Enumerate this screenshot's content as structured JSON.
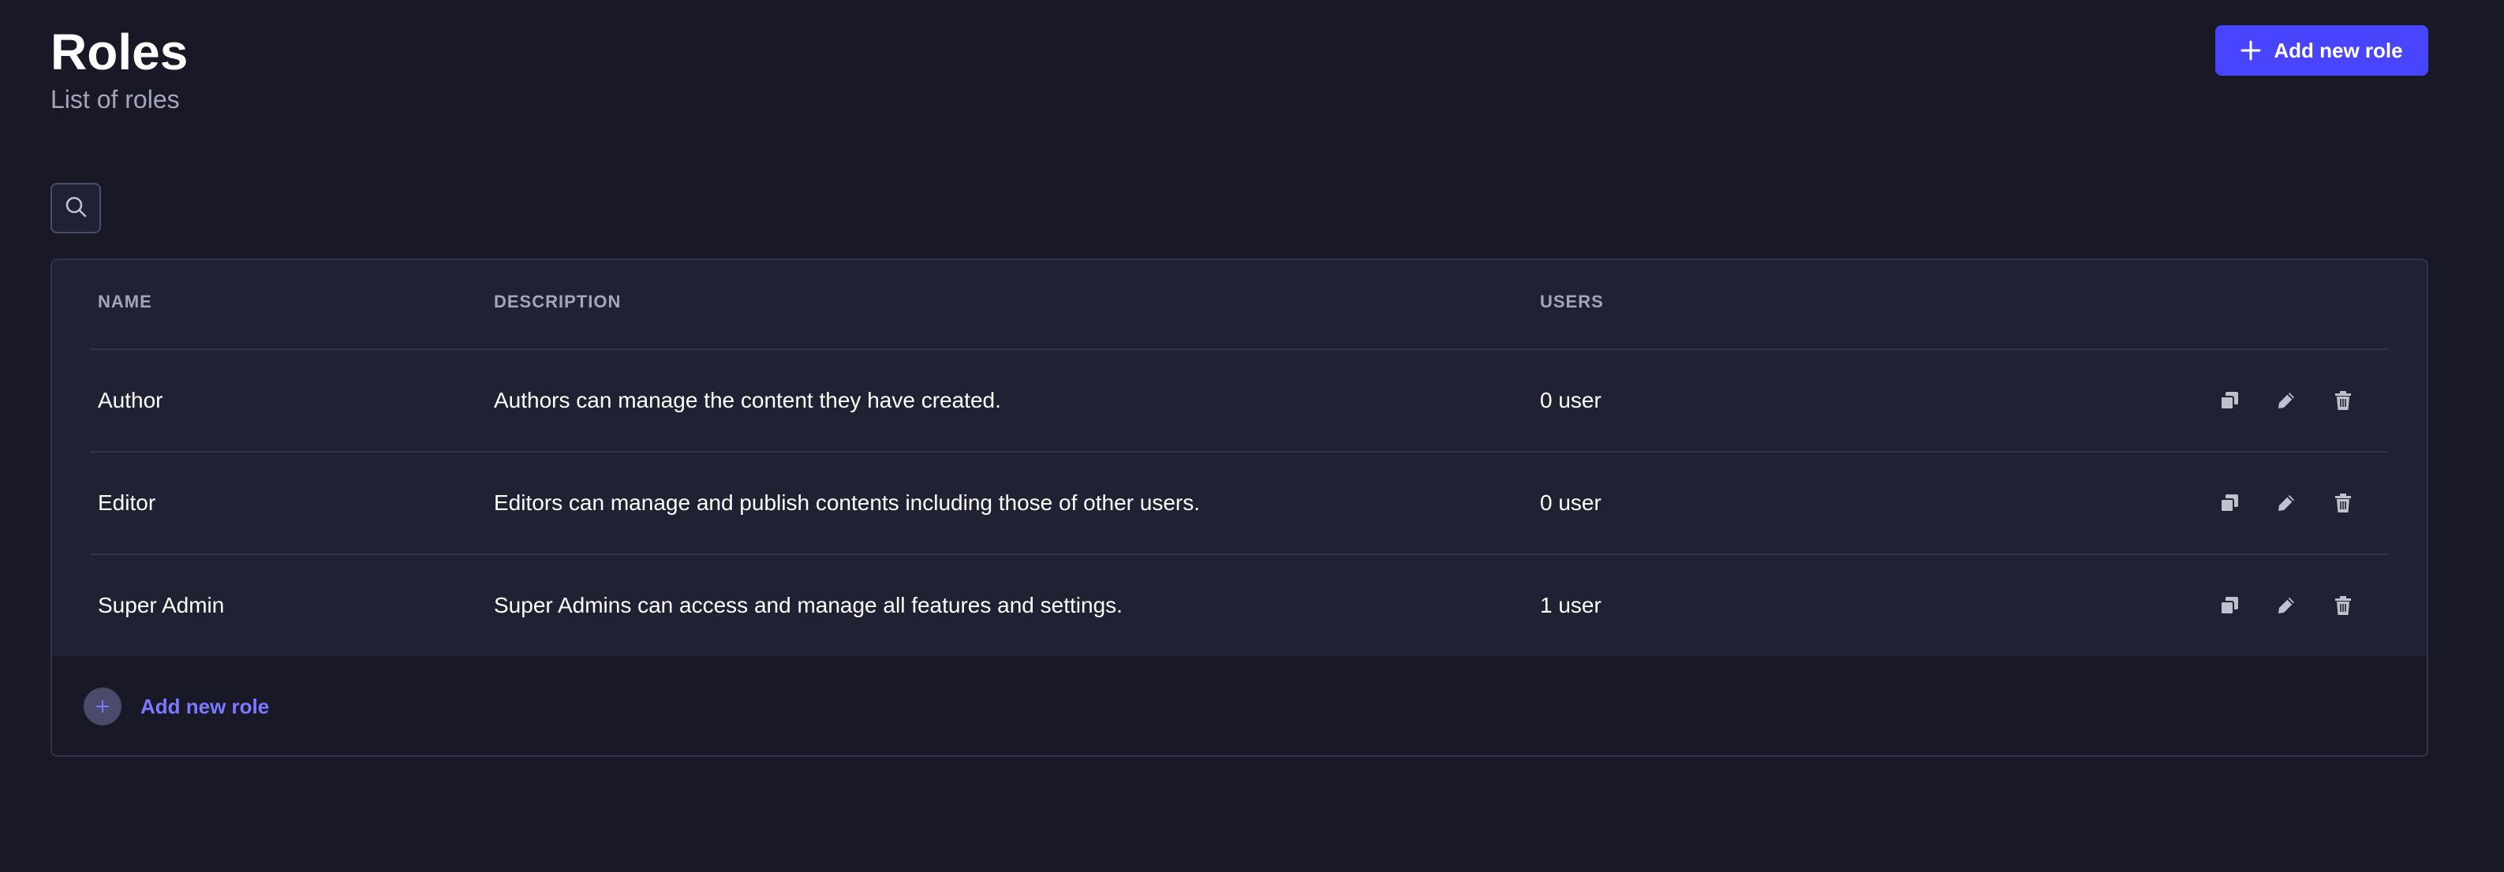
{
  "header": {
    "title": "Roles",
    "subtitle": "List of roles",
    "add_button_label": "Add new role",
    "add_button_icon": "plus-icon"
  },
  "search": {
    "icon": "search-icon"
  },
  "table": {
    "columns": [
      "NAME",
      "DESCRIPTION",
      "USERS"
    ],
    "rows": [
      {
        "name": "Author",
        "description": "Authors can manage the content they have created.",
        "users": "0 user"
      },
      {
        "name": "Editor",
        "description": "Editors can manage and publish contents including those of other users.",
        "users": "0 user"
      },
      {
        "name": "Super Admin",
        "description": "Super Admins can access and manage all features and settings.",
        "users": "1 user"
      }
    ],
    "row_actions": [
      "duplicate-icon",
      "pencil-icon",
      "trash-icon"
    ]
  },
  "footer": {
    "add_label": "Add new role",
    "add_icon": "plus-icon"
  },
  "colors": {
    "background": "#181826",
    "surface": "#212134",
    "border": "#32324d",
    "primary": "#4945ff",
    "primary_text": "#7b79ff",
    "muted_text": "#a5a5ba"
  }
}
